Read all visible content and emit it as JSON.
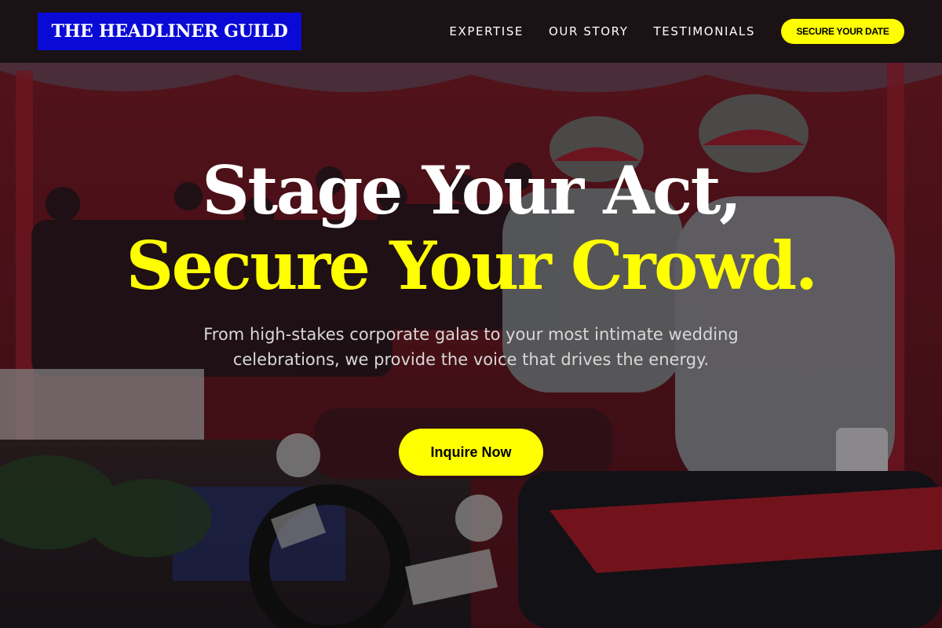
{
  "header": {
    "logo": "THE HEADLINER GUILD",
    "nav": [
      "EXPERTISE",
      "OUR STORY",
      "TESTIMONIALS"
    ],
    "cta": "SECURE YOUR DATE"
  },
  "hero": {
    "title_line1": "Stage Your Act,",
    "title_line2": "Secure Your Crowd.",
    "subtitle": "From high-stakes corporate galas to your most intimate wedding celebrations, we provide the voice that drives the energy.",
    "cta": "Inquire Now"
  },
  "colors": {
    "accent_yellow": "#ffff00",
    "logo_blue": "#0a0ad6",
    "header_dark": "#161214"
  }
}
